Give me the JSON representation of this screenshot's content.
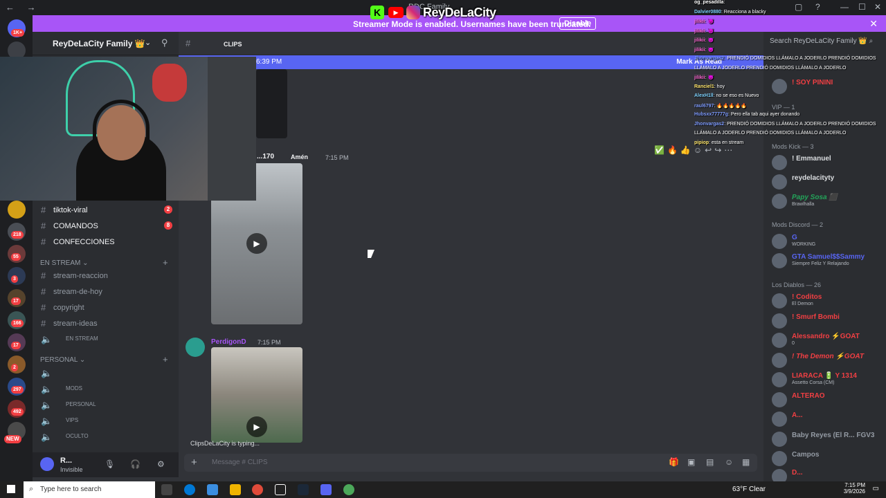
{
  "window": {
    "title": "RDC Family",
    "nav_back": "←",
    "nav_fwd": "→"
  },
  "overlay_logo": {
    "kick": "K",
    "youtube": "▶",
    "name": "ReyDeLaCity"
  },
  "streamer_banner": {
    "text": "Streamer Mode is enabled. Usernames have been truncated.",
    "button": "Disable",
    "close": "✕"
  },
  "server": {
    "name": "ReyDeLaCity Family 👑"
  },
  "channels": {
    "items_top": [
      {
        "label": "tiktok-viral",
        "badge": "2"
      },
      {
        "label": "COMANDOS",
        "badge": "8"
      },
      {
        "label": "CONFECCIONES",
        "badge": ""
      }
    ],
    "categories": [
      {
        "label": "EN STREAM"
      },
      {
        "label": "PERSONAL"
      }
    ],
    "stream_items": [
      {
        "label": "stream-reaccion"
      },
      {
        "label": "stream-de-hoy"
      },
      {
        "label": "copyright"
      },
      {
        "label": "stream-ideas"
      },
      {
        "label": "EN STREAM"
      }
    ],
    "personal_items": [
      {
        "label": ""
      },
      {
        "label": "MODS"
      },
      {
        "label": "PERSONAL"
      },
      {
        "label": "VIPS"
      },
      {
        "label": "OCULTO"
      }
    ]
  },
  "user_panel": {
    "name": "R...",
    "status": "Invisible"
  },
  "guild_badges": [
    "1K+",
    "218",
    "55",
    "3",
    "17",
    "166",
    "17",
    "2",
    "297",
    "492",
    "NEW"
  ],
  "channel_header": {
    "name": "CLIPS"
  },
  "new_messages_bar": {
    "time": "6:39 PM",
    "mark": "Mark As Read"
  },
  "messages": [
    {
      "author": "...170",
      "tag": "Amén",
      "time": "7:15 PM"
    },
    {
      "author": "PerdigonD",
      "time": "7:15 PM"
    }
  ],
  "typing": "ClipsDeLaCity is typing...",
  "composer": {
    "placeholder": "Message #",
    "channel": "CLIPS"
  },
  "members": {
    "search_placeholder": "Search ReyDeLaCity Family 👑",
    "top_member": "! SOY PININI",
    "cat_vip": "VIP — 1",
    "cat_mods_kick": "Mods Kick — 3",
    "mods_kick": [
      {
        "name": "! Emmanuel",
        "color": "#f2f3f5",
        "sub": ""
      },
      {
        "name": "reydelacityty",
        "color": "#f2f3f5",
        "sub": ""
      },
      {
        "name": "Papy Sosa ⬛",
        "color": "#23a55a",
        "sub": "Brawlhalla"
      }
    ],
    "cat_mods_discord": "Mods Discord — 2",
    "mods_discord": [
      {
        "name": "G",
        "color": "#5865f2",
        "sub": "WORKING"
      },
      {
        "name": "GTA Samuel$$Sammy",
        "color": "#5865f2",
        "sub": "Siempre Feliz Y Relajando"
      }
    ],
    "cat_diablos": "Los Diablos — 26",
    "diablos": [
      {
        "name": "! Coditos",
        "color": "#f23f43",
        "sub": "El Demon"
      },
      {
        "name": "! Smurf Bombi",
        "color": "#f23f43",
        "sub": ""
      },
      {
        "name": "Alessandro ⚡GOAT",
        "color": "#f23f43",
        "sub": "0"
      },
      {
        "name": "! The Demon ⚡GOAT",
        "color": "#f23f43",
        "sub": ""
      },
      {
        "name": "LIARACA 🔋 Y 1314",
        "color": "#f23f43",
        "sub": "Assetto Corsa (CM)"
      },
      {
        "name": "ALTERAO",
        "color": "#f23f43",
        "sub": ""
      },
      {
        "name": "A...",
        "color": "#f23f43",
        "sub": ""
      },
      {
        "name": "Baby Reyes (El R... FGV3",
        "color": "#949ba4",
        "sub": ""
      },
      {
        "name": "Campos",
        "color": "#949ba4",
        "sub": ""
      },
      {
        "name": "D...",
        "color": "#f23f43",
        "sub": ""
      }
    ]
  },
  "stream_chat": [
    {
      "user": "og_pesadilla",
      "msg": ":",
      "color": "#ffffff"
    },
    {
      "user": "Dalvier0880",
      "msg": ": Reacciona a blacky",
      "color": "#7fd3ff"
    },
    {
      "user": "jilikii",
      "msg": ": 👿",
      "color": "#ff6ad5"
    },
    {
      "user": "jilikii",
      "msg": ": 👿",
      "color": "#ff6ad5"
    },
    {
      "user": "jilikii",
      "msg": ": 👿",
      "color": "#ff6ad5"
    },
    {
      "user": "jilikii",
      "msg": ": 👿",
      "color": "#ff6ad5"
    },
    {
      "user": "Jhonvargas2",
      "msg": ": PRENDIÓ DOMIDIOS LLÁMALO A JODERLO PRENDIÓ DOMIDIOS",
      "color": "#7f9cff"
    },
    {
      "user": "",
      "msg": "LLÁMALO A JODERLO PRENDIÓ DOMIDIOS LLÁMALO A JODERLO",
      "color": "#ffffff"
    },
    {
      "user": "jilikii",
      "msg": ": 👿",
      "color": "#ff6ad5"
    },
    {
      "user": "Ranciel1",
      "msg": ": hoy",
      "color": "#ffe66d"
    },
    {
      "user": "AlexH1ll",
      "msg": ": no se eso es Nuevo",
      "color": "#7fd3ff"
    },
    {
      "user": "raul6797",
      "msg": ": 🔥🔥🔥🔥🔥",
      "color": "#7f9cff"
    },
    {
      "user": "Hubsxx77777g",
      "msg": ": Pero ella tab aqui ayer donando",
      "color": "#7f9cff"
    },
    {
      "user": "Jhonvargas2",
      "msg": ": PRENDIÓ DOMIDIOS LLÁMALO A JODERLO PRENDIÓ DOMIDIOS",
      "color": "#7f9cff"
    },
    {
      "user": "",
      "msg": "LLÁMALO A JODERLO PRENDIÓ DOMIDIOS LLÁMALO A JODERLO",
      "color": "#ffffff"
    },
    {
      "user": "pipiop",
      "msg": ": esta en stream",
      "color": "#ffe66d"
    }
  ],
  "taskbar": {
    "search_placeholder": "Type here to search",
    "weather": "63°F  Clear",
    "time": "7:15 PM",
    "date": "3/9/2026"
  }
}
